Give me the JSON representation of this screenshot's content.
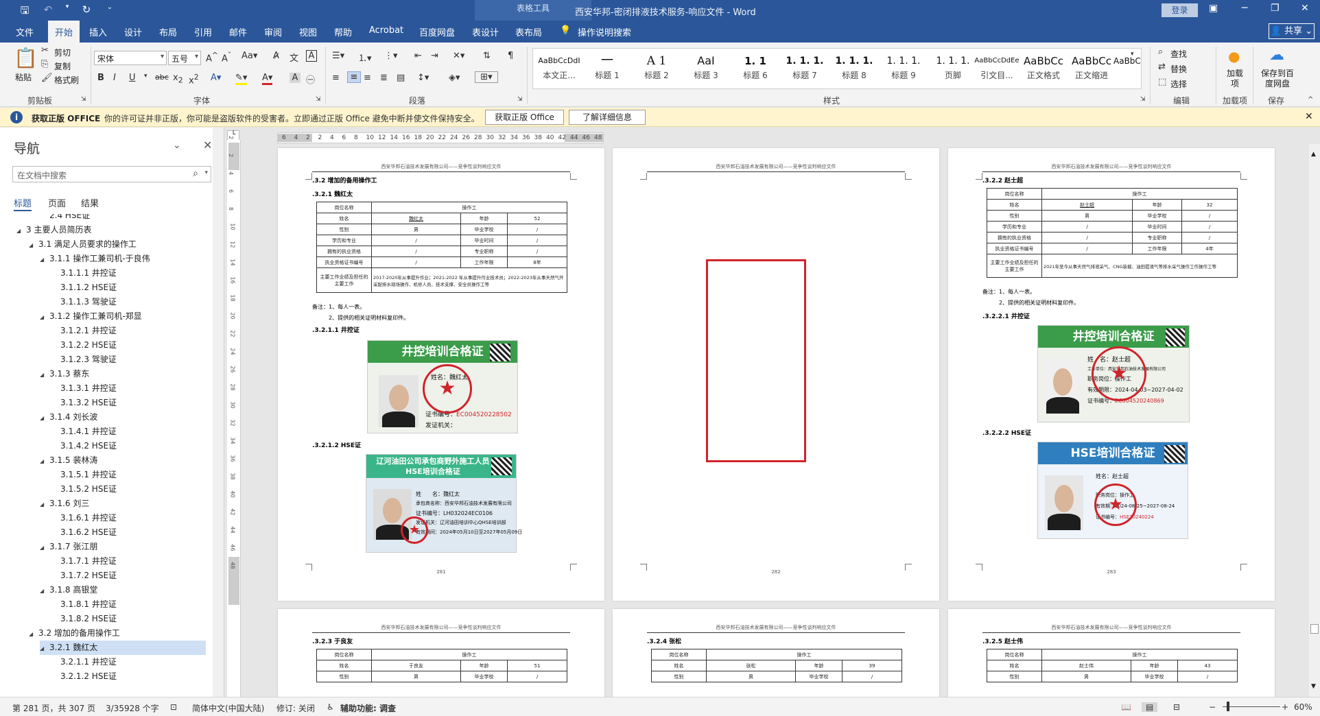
{
  "title_bar": {
    "context_tab": "表格工具",
    "doc_title": "西安华邦-密闭排液技术服务-响应文件  -  Word",
    "login": "登录"
  },
  "tabs": [
    "文件",
    "开始",
    "插入",
    "设计",
    "布局",
    "引用",
    "邮件",
    "审阅",
    "视图",
    "帮助",
    "Acrobat",
    "百度网盘",
    "表设计",
    "表布局",
    "操作说明搜索"
  ],
  "share": "共享",
  "ribbon": {
    "clipboard": {
      "paste": "粘贴",
      "cut": "剪切",
      "copy": "复制",
      "format_painter": "格式刷",
      "label": "剪贴板"
    },
    "font": {
      "name": "宋体",
      "size": "五号",
      "label": "字体"
    },
    "paragraph": {
      "label": "段落"
    },
    "styles": {
      "label": "样式",
      "items": [
        {
          "sample": "AaBbCcDdI",
          "name": "本文正..."
        },
        {
          "sample": "一",
          "name": "标题 1"
        },
        {
          "sample": "A 1",
          "name": "标题 2"
        },
        {
          "sample": "AaI",
          "name": "标题 3"
        },
        {
          "sample": "1. 1",
          "name": "标题 6"
        },
        {
          "sample": "1. 1. 1.",
          "name": "标题 7"
        },
        {
          "sample": "1. 1. 1.",
          "name": "标题 8"
        },
        {
          "sample": "1. 1. 1.",
          "name": "标题 9"
        },
        {
          "sample": "1. 1. 1.",
          "name": "页脚"
        },
        {
          "sample": "AaBbCcDdEe",
          "name": "引文目..."
        },
        {
          "sample": "AaBbCc",
          "name": "正文格式"
        },
        {
          "sample": "AaBbCc",
          "name": "正文缩进"
        },
        {
          "sample": "AaBbCcDd",
          "name": ""
        }
      ]
    },
    "editing": {
      "find": "查找",
      "replace": "替换",
      "select": "选择",
      "label": "编辑"
    },
    "addins": {
      "button": "加载项",
      "label": "加载项"
    },
    "save": {
      "button": "保存到百度网盘",
      "label": "保存"
    }
  },
  "notice": {
    "bold": "获取正版 OFFICE",
    "message": "你的许可证并非正版，你可能是盗版软件的受害者。立即通过正版 Office 避免中断并使文件保持安全。",
    "btn_get": "获取正版 Office",
    "btn_learn": "了解详细信息"
  },
  "nav": {
    "title": "导航",
    "search_placeholder": "在文档中搜索",
    "tabs": [
      "标题",
      "页面",
      "结果"
    ],
    "tree": [
      {
        "label": "2.4 HSE证",
        "level": 3,
        "arrow": false
      },
      {
        "label": "3 主要人员简历表",
        "level": 1,
        "arrow": true
      },
      {
        "label": "3.1 满足人员要求的操作工",
        "level": 2,
        "arrow": true
      },
      {
        "label": "3.1.1 操作工兼司机-于良伟",
        "level": 3,
        "arrow": true
      },
      {
        "label": "3.1.1.1 井控证",
        "level": 4,
        "arrow": false
      },
      {
        "label": "3.1.1.2 HSE证",
        "level": 4,
        "arrow": false
      },
      {
        "label": "3.1.1.3 驾驶证",
        "level": 4,
        "arrow": false
      },
      {
        "label": "3.1.2 操作工兼司机-郑显",
        "level": 3,
        "arrow": true
      },
      {
        "label": "3.1.2.1 井控证",
        "level": 4,
        "arrow": false
      },
      {
        "label": "3.1.2.2 HSE证",
        "level": 4,
        "arrow": false
      },
      {
        "label": "3.1.2.3 驾驶证",
        "level": 4,
        "arrow": false
      },
      {
        "label": "3.1.3 蔡东",
        "level": 3,
        "arrow": true
      },
      {
        "label": "3.1.3.1 井控证",
        "level": 4,
        "arrow": false
      },
      {
        "label": "3.1.3.2 HSE证",
        "level": 4,
        "arrow": false
      },
      {
        "label": "3.1.4 刘长波",
        "level": 3,
        "arrow": true
      },
      {
        "label": "3.1.4.1 井控证",
        "level": 4,
        "arrow": false
      },
      {
        "label": "3.1.4.2 HSE证",
        "level": 4,
        "arrow": false
      },
      {
        "label": "3.1.5 裴林涛",
        "level": 3,
        "arrow": true
      },
      {
        "label": "3.1.5.1 井控证",
        "level": 4,
        "arrow": false
      },
      {
        "label": "3.1.5.2 HSE证",
        "level": 4,
        "arrow": false
      },
      {
        "label": "3.1.6 刘三",
        "level": 3,
        "arrow": true
      },
      {
        "label": "3.1.6.1 井控证",
        "level": 4,
        "arrow": false
      },
      {
        "label": "3.1.6.2 HSE证",
        "level": 4,
        "arrow": false
      },
      {
        "label": "3.1.7 张江朋",
        "level": 3,
        "arrow": true
      },
      {
        "label": "3.1.7.1 井控证",
        "level": 4,
        "arrow": false
      },
      {
        "label": "3.1.7.2 HSE证",
        "level": 4,
        "arrow": false
      },
      {
        "label": "3.1.8 高银堂",
        "level": 3,
        "arrow": true
      },
      {
        "label": "3.1.8.1 井控证",
        "level": 4,
        "arrow": false
      },
      {
        "label": "3.1.8.2 HSE证",
        "level": 4,
        "arrow": false
      },
      {
        "label": "3.2 增加的备用操作工",
        "level": 2,
        "arrow": true
      },
      {
        "label": "3.2.1 魏红太",
        "level": 3,
        "arrow": true,
        "selected": true
      },
      {
        "label": "3.2.1.1 井控证",
        "level": 4,
        "arrow": false
      },
      {
        "label": "3.2.1.2 HSE证",
        "level": 4,
        "arrow": false
      }
    ]
  },
  "hruler": [
    "6",
    "4",
    "2",
    "2",
    "4",
    "6",
    "8",
    "10",
    "12",
    "14",
    "16",
    "18",
    "20",
    "22",
    "24",
    "26",
    "28",
    "30",
    "32",
    "34",
    "36",
    "38",
    "40",
    "42",
    "44",
    "46",
    "48"
  ],
  "vruler": [
    "2",
    "2",
    "4",
    "6",
    "8",
    "10",
    "12",
    "14",
    "16",
    "18",
    "20",
    "22",
    "24",
    "26",
    "28",
    "30",
    "32",
    "34",
    "36",
    "38",
    "40",
    "42",
    "44",
    "46",
    "48"
  ],
  "doc": {
    "header_text": "西安华邦石油技术发展有限公司——竞争性谈判响应文件",
    "page1": {
      "h1": ".3.2 增加的备用操作工",
      "h2": ".3.2.1 魏红太",
      "table": [
        [
          "岗位名称",
          "操作工",
          "",
          ""
        ],
        [
          "姓名",
          "魏红太",
          "年龄",
          "52"
        ],
        [
          "性别",
          "男",
          "毕业学校",
          "/"
        ],
        [
          "学历和专业",
          "/",
          "毕业时间",
          "/"
        ],
        [
          "拥有的执业资格",
          "/",
          "专业职称",
          "/"
        ],
        [
          "执业资格证书编号",
          "/",
          "工作年限",
          "8年"
        ]
      ],
      "work_label": "主要工作业绩及担任的主要工作",
      "work_text": "2017-2020年从事提升作业；2021-2022 年从事提升作业技术员；2022-2023年从事天然气开采配排水现场操作、机修人员、技术支撑、安全员操作工等",
      "note1": "备注：1、每人一表。",
      "note2": "2、提供的相关证明材料复印件。",
      "sub1": ".3.2.1.1 井控证",
      "sub2": ".3.2.1.2 HSE证",
      "footer": "281",
      "card1": {
        "title": "井控培训合格证",
        "name": "魏红太",
        "issuer_label": "发证机关：",
        "cert_label": "证书编号：",
        "cert_no": "EC004520228502"
      },
      "card2": {
        "title": "辽河油田公司承包商野外施工人员HSE培训合格证",
        "name": "魏红太",
        "company": "西安华邦石油技术发展有限公司",
        "cert_no": "LH032024EC0106",
        "issuer": "辽河油田培训中心QHSE培训部",
        "valid": "2024年05月10日至2027年05月09日"
      }
    },
    "page2": {
      "footer": "282"
    },
    "page3": {
      "h2": ".3.2.2 赵士超",
      "table": [
        [
          "岗位名称",
          "操作工",
          "",
          ""
        ],
        [
          "姓名",
          "赵士超",
          "年龄",
          "32"
        ],
        [
          "性别",
          "男",
          "毕业学校",
          "/"
        ],
        [
          "学历和专业",
          "/",
          "毕业时间",
          "/"
        ],
        [
          "拥有的执业资格",
          "/",
          "专业职称",
          "/"
        ],
        [
          "执业资格证书编号",
          "/",
          "工作年限",
          "4年"
        ]
      ],
      "work_label": "主要工作业绩及担任的主要工作",
      "work_text": "2021年至今从事天然气排液采气、CNG装载、油田提液气等排水采气操作工作操作工等",
      "note1": "备注：1、每人一表。",
      "note2": "2、提供的相关证明材料复印件。",
      "sub1": ".3.2.2.1 井控证",
      "sub2": ".3.2.2.2 HSE证",
      "footer": "283",
      "card1": {
        "title": "井控培训合格证",
        "name": "赵士超",
        "company": "西安华邦石油技术发展有限公司",
        "job": "操作工",
        "valid": "2024-04-03~2027-04-02",
        "cert_no": "EC004520240869"
      },
      "card2": {
        "title": "HSE培训合格证",
        "name": "赵士超",
        "job": "操作工",
        "valid": "2024-08-25~2027-08-24",
        "cert_no": "HSE20240224"
      }
    },
    "page4": {
      "h2": ".3.2.3 于良友",
      "row2": [
        "姓名",
        "于良友",
        "年龄",
        "51"
      ],
      "row1": [
        "岗位名称",
        "操作工"
      ],
      "row3": [
        "性别",
        "男",
        "毕业学校",
        "/"
      ]
    },
    "page5": {
      "h2": ".3.2.4 张松",
      "row2": [
        "姓名",
        "张松",
        "年龄",
        "39"
      ],
      "row1": [
        "岗位名称",
        "操作工"
      ],
      "row3": [
        "性别",
        "男",
        "毕业学校",
        "/"
      ]
    },
    "page6": {
      "h2": ".3.2.5 赵士伟",
      "row2": [
        "姓名",
        "赵士伟",
        "年龄",
        "43"
      ],
      "row1": [
        "岗位名称",
        "操作工"
      ],
      "row3": [
        "性别",
        "男",
        "毕业学校",
        "/"
      ]
    }
  },
  "status": {
    "page": "第 281 页，共 307 页",
    "words": "3/35928 个字",
    "lang": "简体中文(中国大陆)",
    "track": "修订: 关闭",
    "access": "辅助功能: 调查",
    "zoom": "60%"
  },
  "colors": {
    "brand": "#2b579a",
    "notice_bg": "#fff4ce",
    "seal_red": "#d0232b",
    "card_green": "#3b9c4a",
    "card_blue": "#2f7fbf"
  }
}
